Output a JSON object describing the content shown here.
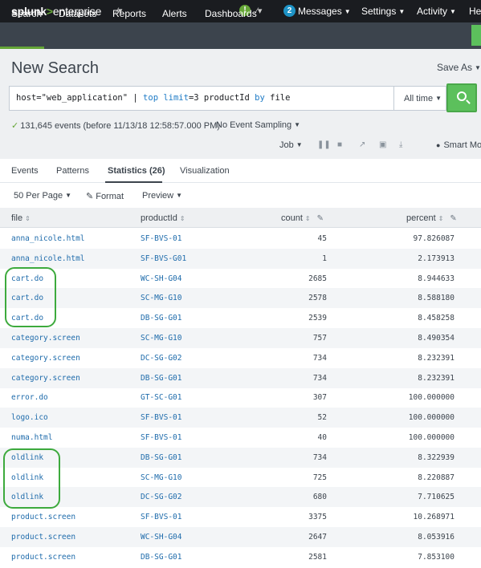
{
  "topbar": {
    "logo_main": "splunk",
    "logo_gt": ">",
    "logo_enterprise": "enterprise",
    "messages_count": "2",
    "messages_label": "Messages",
    "settings_label": "Settings",
    "activity_label": "Activity",
    "help_label": "He"
  },
  "appnav": {
    "items": [
      "Search",
      "Datasets",
      "Reports",
      "Alerts",
      "Dashboards"
    ],
    "active": "Search"
  },
  "search": {
    "title": "New Search",
    "save_as": "Save As",
    "query_host": "host=\"web_application\" | ",
    "query_top": "top",
    "query_limit": " limit",
    "query_mid": "=3 productId ",
    "query_by": "by",
    "query_end": " file",
    "time_range": "All time",
    "events_status": "131,645 events (before 11/13/18 12:58:57.000 PM)",
    "sampling": "No Event Sampling",
    "job_label": "Job",
    "smart_mode": "Smart Mo"
  },
  "tabs": {
    "events": "Events",
    "patterns": "Patterns",
    "statistics": "Statistics (26)",
    "visualization": "Visualization"
  },
  "controls": {
    "per_page": "50 Per Page",
    "format": "Format",
    "preview": "Preview"
  },
  "table": {
    "columns": [
      "file",
      "productId",
      "count",
      "percent"
    ],
    "rows": [
      {
        "file": "anna_nicole.html",
        "productId": "SF-BVS-01",
        "count": "45",
        "percent": "97.826087"
      },
      {
        "file": "anna_nicole.html",
        "productId": "SF-BVS-G01",
        "count": "1",
        "percent": "2.173913"
      },
      {
        "file": "cart.do",
        "productId": "WC-SH-G04",
        "count": "2685",
        "percent": "8.944633"
      },
      {
        "file": "cart.do",
        "productId": "SC-MG-G10",
        "count": "2578",
        "percent": "8.588180"
      },
      {
        "file": "cart.do",
        "productId": "DB-SG-G01",
        "count": "2539",
        "percent": "8.458258"
      },
      {
        "file": "category.screen",
        "productId": "SC-MG-G10",
        "count": "757",
        "percent": "8.490354"
      },
      {
        "file": "category.screen",
        "productId": "DC-SG-G02",
        "count": "734",
        "percent": "8.232391"
      },
      {
        "file": "category.screen",
        "productId": "DB-SG-G01",
        "count": "734",
        "percent": "8.232391"
      },
      {
        "file": "error.do",
        "productId": "GT-SC-G01",
        "count": "307",
        "percent": "100.000000"
      },
      {
        "file": "logo.ico",
        "productId": "SF-BVS-01",
        "count": "52",
        "percent": "100.000000"
      },
      {
        "file": "numa.html",
        "productId": "SF-BVS-01",
        "count": "40",
        "percent": "100.000000"
      },
      {
        "file": "oldlink",
        "productId": "DB-SG-G01",
        "count": "734",
        "percent": "8.322939"
      },
      {
        "file": "oldlink",
        "productId": "SC-MG-G10",
        "count": "725",
        "percent": "8.220887"
      },
      {
        "file": "oldlink",
        "productId": "DC-SG-G02",
        "count": "680",
        "percent": "7.710625"
      },
      {
        "file": "product.screen",
        "productId": "SF-BVS-01",
        "count": "3375",
        "percent": "10.268971"
      },
      {
        "file": "product.screen",
        "productId": "WC-SH-G04",
        "count": "2647",
        "percent": "8.053916"
      },
      {
        "file": "product.screen",
        "productId": "DB-SG-G01",
        "count": "2581",
        "percent": "7.853100"
      }
    ]
  },
  "colors": {
    "topbar": "#1a1c20",
    "appbar": "#3c444d",
    "accent_green": "#65a637",
    "search_button": "#5cc05c",
    "highlight": "#3daa3d",
    "link_blue": "#1e6bab"
  }
}
